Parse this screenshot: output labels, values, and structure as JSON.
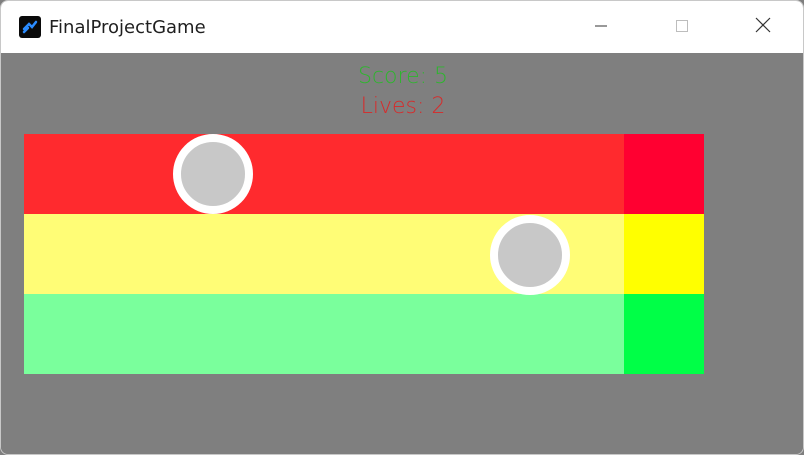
{
  "window": {
    "title": "FinalProjectGame",
    "icon": "game-app-icon",
    "controls": {
      "minimize_icon": "minimize-icon",
      "maximize_icon": "maximize-icon",
      "close_icon": "close-icon"
    }
  },
  "hud": {
    "score": "Score: 5",
    "lives": "Lives: 2",
    "score_color": "#2fb52f",
    "lives_color": "#d82a2a"
  },
  "board": {
    "background": "#7f7f7f",
    "lanes": [
      {
        "color": "#ff2a2e",
        "end_zone_color": "#ff0031"
      },
      {
        "color": "#fffd76",
        "end_zone_color": "#ffff00"
      },
      {
        "color": "#7aff9c",
        "end_zone_color": "#00ff47"
      }
    ],
    "balls": [
      {
        "lane": 0,
        "fill": "#c8c8c8",
        "ring": "#ffffff"
      },
      {
        "lane": 1,
        "fill": "#c8c8c8",
        "ring": "#ffffff"
      }
    ]
  }
}
